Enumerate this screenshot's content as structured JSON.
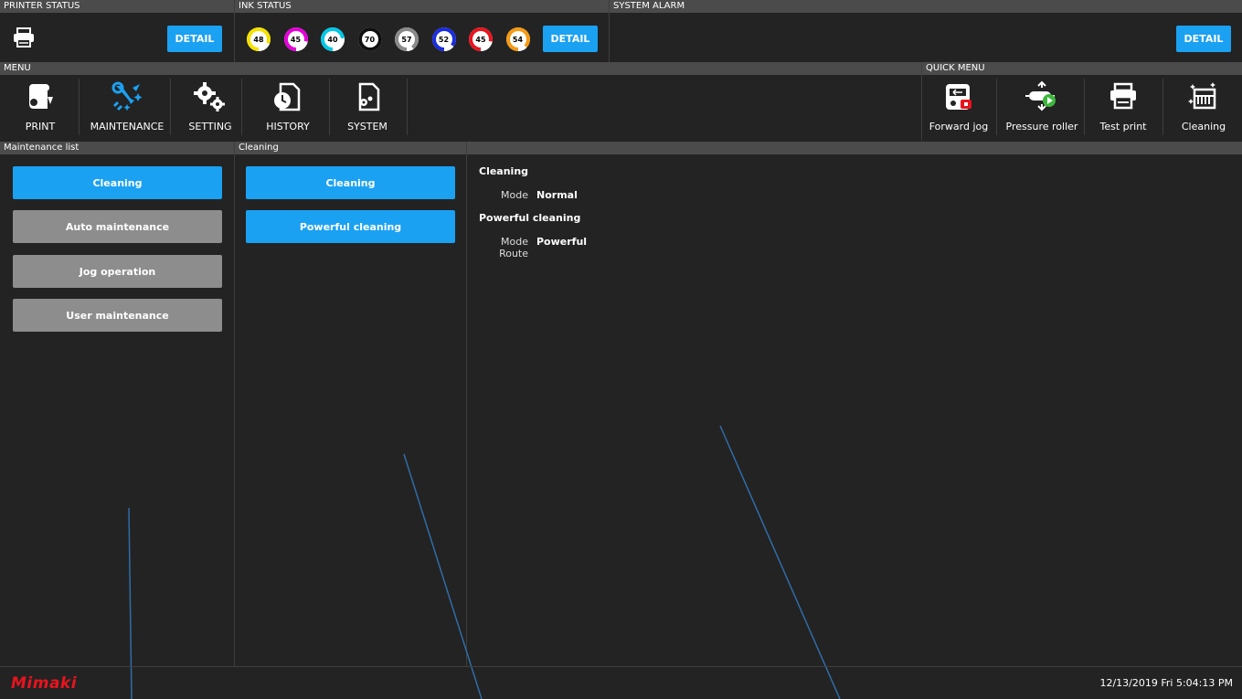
{
  "printer_status": {
    "header": "PRINTER STATUS",
    "detail_label": "DETAIL"
  },
  "ink_status": {
    "header": "INK STATUS",
    "detail_label": "DETAIL",
    "inks": [
      {
        "value": "48",
        "color": "#f5e100"
      },
      {
        "value": "45",
        "color": "#e400d8"
      },
      {
        "value": "40",
        "color": "#00c8e6"
      },
      {
        "value": "70",
        "color": "#111111"
      },
      {
        "value": "57",
        "color": "#8a8a8a"
      },
      {
        "value": "52",
        "color": "#1a2de0"
      },
      {
        "value": "45",
        "color": "#e8141e"
      },
      {
        "value": "54",
        "color": "#f59a14"
      }
    ]
  },
  "system_alarm": {
    "header": "SYSTEM ALARM",
    "detail_label": "DETAIL"
  },
  "menu": {
    "header": "MENU",
    "items": [
      {
        "label": "PRINT",
        "icon": "print-roll-icon"
      },
      {
        "label": "MAINTENANCE",
        "icon": "wrench-sparkle-icon"
      },
      {
        "label": "SETTING",
        "icon": "gears-icon"
      },
      {
        "label": "HISTORY",
        "icon": "history-clock-icon"
      },
      {
        "label": "SYSTEM",
        "icon": "system-doc-gear-icon"
      }
    ]
  },
  "quick_menu": {
    "header": "QUICK MENU",
    "items": [
      {
        "label": "Forward jog",
        "icon": "forward-jog-icon"
      },
      {
        "label": "Pressure roller",
        "icon": "pressure-roller-icon"
      },
      {
        "label": "Test print",
        "icon": "test-print-icon"
      },
      {
        "label": "Cleaning",
        "icon": "cleaning-icon"
      }
    ]
  },
  "maintenance_list": {
    "header": "Maintenance list",
    "items": [
      {
        "label": "Cleaning",
        "active": true
      },
      {
        "label": "Auto maintenance",
        "active": false
      },
      {
        "label": "Jog operation",
        "active": false
      },
      {
        "label": "User maintenance",
        "active": false
      }
    ]
  },
  "cleaning_panel": {
    "header": "Cleaning",
    "items": [
      {
        "label": "Cleaning"
      },
      {
        "label": "Powerful cleaning"
      }
    ]
  },
  "details": {
    "cleaning_title": "Cleaning",
    "cleaning_mode_key": "Mode",
    "cleaning_mode_val": "Normal",
    "powerful_title": "Powerful cleaning",
    "powerful_mode_key": "Mode",
    "powerful_mode_val": "Powerful",
    "powerful_route_key": "Route"
  },
  "footer": {
    "logo": "Mimaki",
    "datetime": "12/13/2019 Fri 5:04:13 PM"
  },
  "colors": {
    "accent": "#1ba1f2",
    "inactive_button": "#8d8d8d",
    "logo": "#e8141e"
  }
}
